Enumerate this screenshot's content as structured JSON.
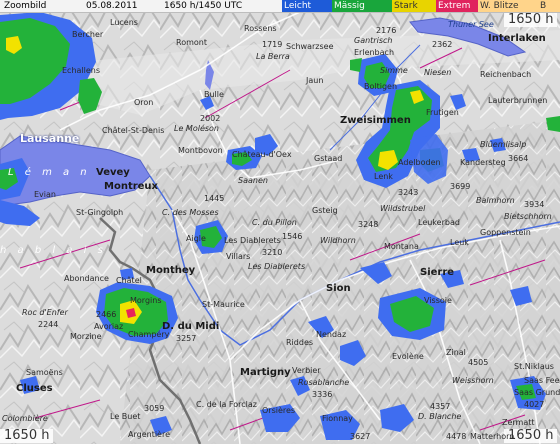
{
  "header": {
    "view_label": "Zoombild",
    "date": "05.08.2011",
    "level_time": "1650 h/1450 UTC",
    "legend": [
      {
        "label": "Leicht",
        "bg": "#1e5bd8",
        "fg": "#ffffff"
      },
      {
        "label": "Mässig",
        "bg": "#19a63c",
        "fg": "#ffffff"
      },
      {
        "label": "Stark",
        "bg": "#e8d400",
        "fg": "#333333"
      },
      {
        "label": "Extrem",
        "bg": "#e0245e",
        "fg": "#ffffff"
      },
      {
        "label": "W. Blitze",
        "bg": "#ffd48a",
        "fg": "#333333"
      },
      {
        "label": "B",
        "bg": "#ffd48a",
        "fg": "#333333"
      }
    ]
  },
  "altitude_labels": {
    "top_right": "1650 h",
    "bottom_left": "1650 h",
    "bottom_right": "1650 h"
  },
  "colors": {
    "light": "#3f6df0",
    "moderate": "#23b23a",
    "strong": "#f2e200",
    "extreme": "#e8245a",
    "track": "#c0188a",
    "lake": "#7a86e8",
    "road": "#ffffff"
  },
  "places": {
    "lucens": "Lucens",
    "bercher": "Bercher",
    "romont": "Romont",
    "rossens": "Rossens",
    "echallens": "Echallens",
    "la_berra": "La Berra",
    "oron": "Oron",
    "bulle": "Bulle",
    "moleson": "Le Moléson",
    "chatel_st_denis": "Châtel-St-Denis",
    "lausanne": "Lausanne",
    "vevey": "Vevey",
    "montreux": "Montreux",
    "montbovon": "Montbovon",
    "chateau_doex": "Château-d'Oex",
    "saanen": "Saanen",
    "gstaad": "Gstaad",
    "evian": "Evian",
    "st_gingolph": "St-Gingolph",
    "c_des_mosses": "C. des Mosses",
    "c_du_pillon": "C. du Pillon",
    "gsteig": "Gsteig",
    "wildhorn": "Wildhorn",
    "les_diablerets": "Les Diablerets",
    "le_diablerets": "Les Diablerets",
    "aigle": "Aigle",
    "villars": "Villars",
    "abondance": "Abondance",
    "chatel": "Châtel",
    "monthey": "Monthey",
    "morgins": "Morgins",
    "st_maurice": "St-Maurice",
    "roc_denfer": "Roc d'Enfer",
    "avoriaz": "Avoriaz",
    "morzine": "Morzine",
    "champery": "Champéry",
    "d_du_midi": "D. du Midi",
    "sion": "Sion",
    "riddes": "Riddes",
    "nendaz": "Nendaz",
    "martigny": "Martigny",
    "verbier": "Verbier",
    "rosablanche": "Rosablanche",
    "samoens": "Samoëns",
    "cluses": "Cluses",
    "colombiere": "Colombière",
    "le_buet": "Le Buet",
    "argentiere": "Argentière",
    "c_de_la_forclaz": "C. de la Forclaz",
    "orsieres": "Orsières",
    "fionnay": "Fionnay",
    "evolene": "Evolène",
    "d_blanche": "D. Blanche",
    "matterhorn": "Matterhorn",
    "zermatt": "Zermatt",
    "weisshorn": "Weisshorn",
    "zinal": "Zinal",
    "vissoie": "Vissoie",
    "sierre": "Sierre",
    "leuk": "Leuk",
    "montana": "Montana",
    "leukerbad": "Leukerbad",
    "st_niklaus": "St.Niklaus",
    "saas_fee": "Saas Fee",
    "saas_grund": "Saas Grund",
    "goppenstein": "Goppenstein",
    "bietschhorn": "Bietschhorn",
    "balmhorn": "Balmhorn",
    "wildstrubel": "Wildstrubel",
    "lenk": "Lenk",
    "adelboden": "Adelboden",
    "kandersteg": "Kandersteg",
    "bluemlisalp": "Blüemlisalp",
    "zweisimmen": "Zweisimmen",
    "frutigen": "Frutigen",
    "boltigen": "Boltigen",
    "jaun": "Jaun",
    "schwarzsee": "Schwarzsee",
    "gantrisch": "Gantrisch",
    "erlenbach": "Erlenbach",
    "simme": "Simme",
    "niesen": "Niesen",
    "interlaken": "Interlaken",
    "reichenbach": "Reichenbach",
    "lauterbrunnen": "Lauterbrunnen",
    "thuner_see": "Thuner See",
    "leman": "L é m a n",
    "chablais": "h a b l a i s",
    "elev_1719": "1719",
    "elev_2176": "2176",
    "elev_2362": "2362",
    "elev_2002": "2002",
    "elev_1445": "1445",
    "elev_1546": "1546",
    "elev_3248": "3248",
    "elev_3210": "3210",
    "elev_3243": "3243",
    "elev_3699": "3699",
    "elev_3664": "3664",
    "elev_3934": "3934",
    "elev_2244": "2244",
    "elev_2466": "2466",
    "elev_3257": "3257",
    "elev_3336": "3336",
    "elev_3059": "3059",
    "elev_4357": "4357",
    "elev_4505": "4505",
    "elev_4478": "4478",
    "elev_3627": "3627",
    "elev_4027": "4027"
  }
}
